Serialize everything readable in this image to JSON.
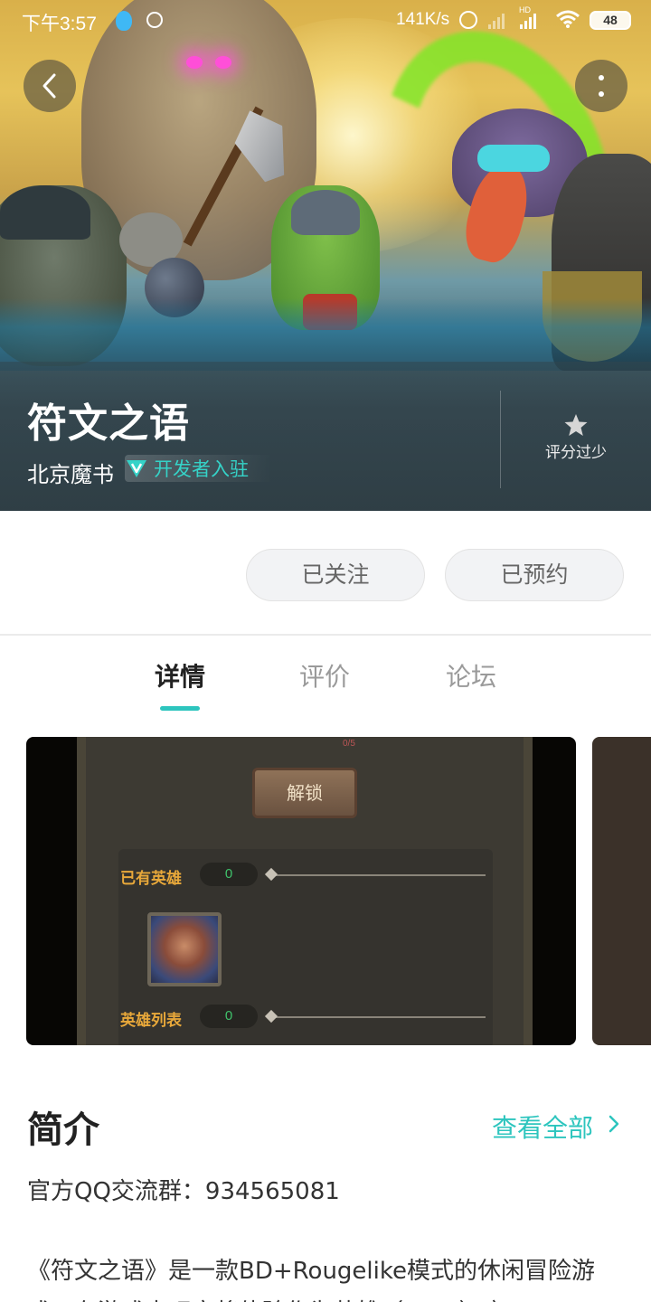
{
  "status_bar": {
    "time": "下午3:57",
    "net_speed": "141K/s",
    "network_label": "HD",
    "battery": "48"
  },
  "header": {
    "back_icon": "chevron-left-icon",
    "more_icon": "vertical-dots-icon"
  },
  "game": {
    "title": "符文之语",
    "developer": "北京魔书",
    "dev_badge": "开发者入驻",
    "rating_label": "评分过少"
  },
  "actions": {
    "follow_label": "已关注",
    "reserve_label": "已预约"
  },
  "tabs": [
    {
      "label": "详情",
      "active": true
    },
    {
      "label": "评价",
      "active": false
    },
    {
      "label": "论坛",
      "active": false
    }
  ],
  "screenshot": {
    "top_mark": "0/5",
    "unlock_label": "解锁",
    "rows": [
      {
        "label": "已有英雄",
        "count": "0"
      },
      {
        "label": "英雄列表",
        "count": "0"
      }
    ]
  },
  "intro": {
    "title": "简介",
    "view_all": "查看全部",
    "qq_group": "官方QQ交流群：934565081",
    "description": "《符文之语》是一款BD+Rougelike模式的休闲冒险游戏，在游戏中玩家将体验作为英雄（Hero）守"
  },
  "colors": {
    "accent": "#2dc5be",
    "pill_bg": "#f2f3f5",
    "title_text": "#222222"
  }
}
